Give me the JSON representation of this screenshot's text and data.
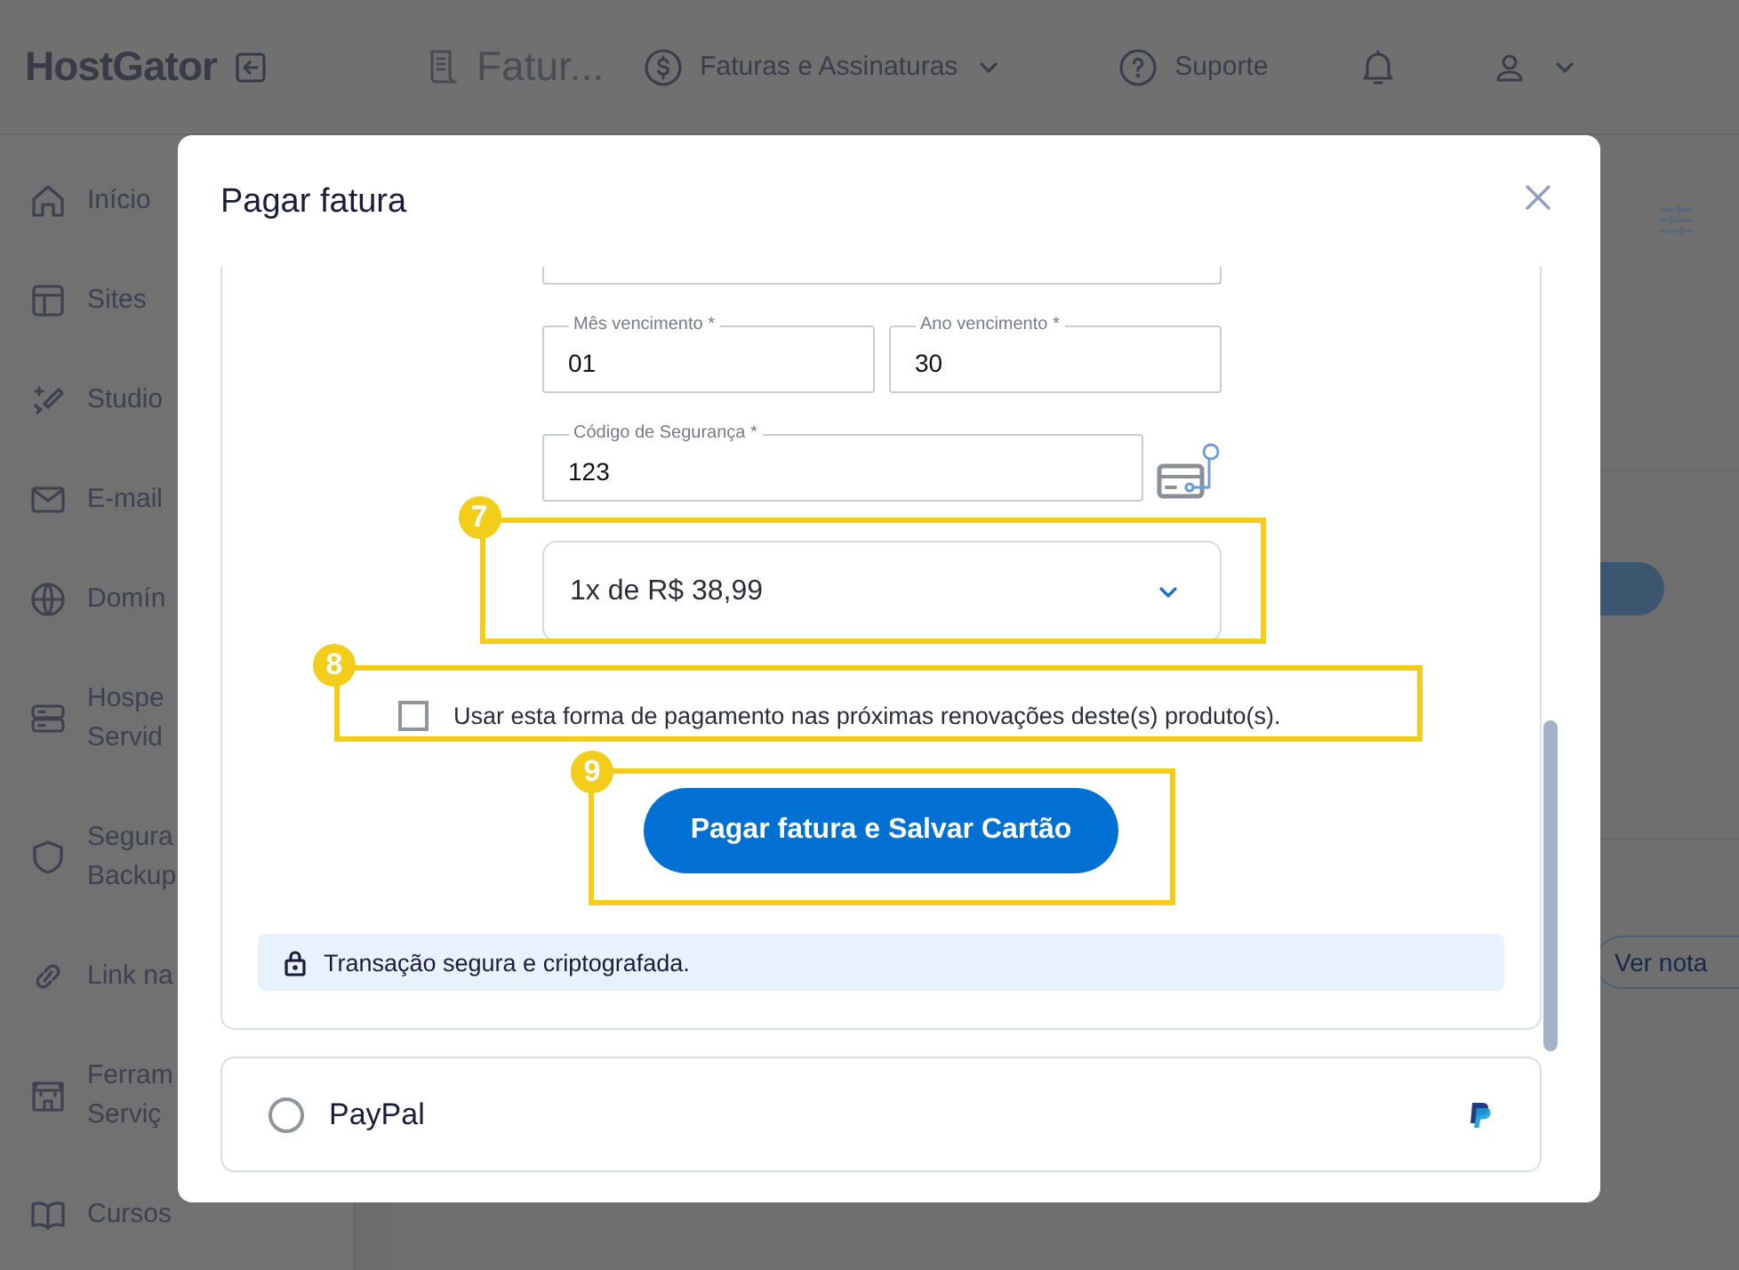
{
  "header": {
    "logo": "HostGator",
    "page_title": "Fatur...",
    "nav": [
      {
        "label": "Faturas e Assinaturas",
        "kind": "dropdown"
      },
      {
        "label": "Suporte",
        "kind": "link"
      }
    ]
  },
  "sidebar": {
    "items": [
      {
        "lines": [
          "Início"
        ]
      },
      {
        "lines": [
          "Sites"
        ]
      },
      {
        "lines": [
          "Studio"
        ]
      },
      {
        "lines": [
          "E-mail"
        ]
      },
      {
        "lines": [
          "Domín"
        ]
      },
      {
        "lines": [
          "Hospe",
          "Servid"
        ]
      },
      {
        "lines": [
          "Segura",
          "Backup"
        ]
      },
      {
        "lines": [
          "Link na"
        ]
      },
      {
        "lines": [
          "Ferram",
          "Serviç"
        ]
      },
      {
        "lines": [
          "Cursos"
        ]
      }
    ]
  },
  "main": {
    "button_label": "Ver nota"
  },
  "dialog": {
    "title": "Pagar fatura",
    "field_rows": [
      [
        {
          "label": "Mês vencimento *",
          "value": "01"
        },
        {
          "label": "Ano vencimento *",
          "value": "30"
        }
      ],
      [
        {
          "label": "Código de Segurança *",
          "value": "123"
        }
      ]
    ],
    "installments": {
      "value": "1x de R$ 38,99",
      "annotation": "7"
    },
    "save_option": {
      "label": "Usar esta forma de pagamento nas próximas renovações deste(s) produto(s).",
      "checked": false,
      "annotation": "8"
    },
    "pay_button": {
      "label": "Pagar fatura e Salvar Cartão",
      "annotation": "9"
    },
    "notice": "Transação segura e criptografada.",
    "payment_methods": [
      {
        "label": "PayPal",
        "selected": false
      }
    ]
  }
}
